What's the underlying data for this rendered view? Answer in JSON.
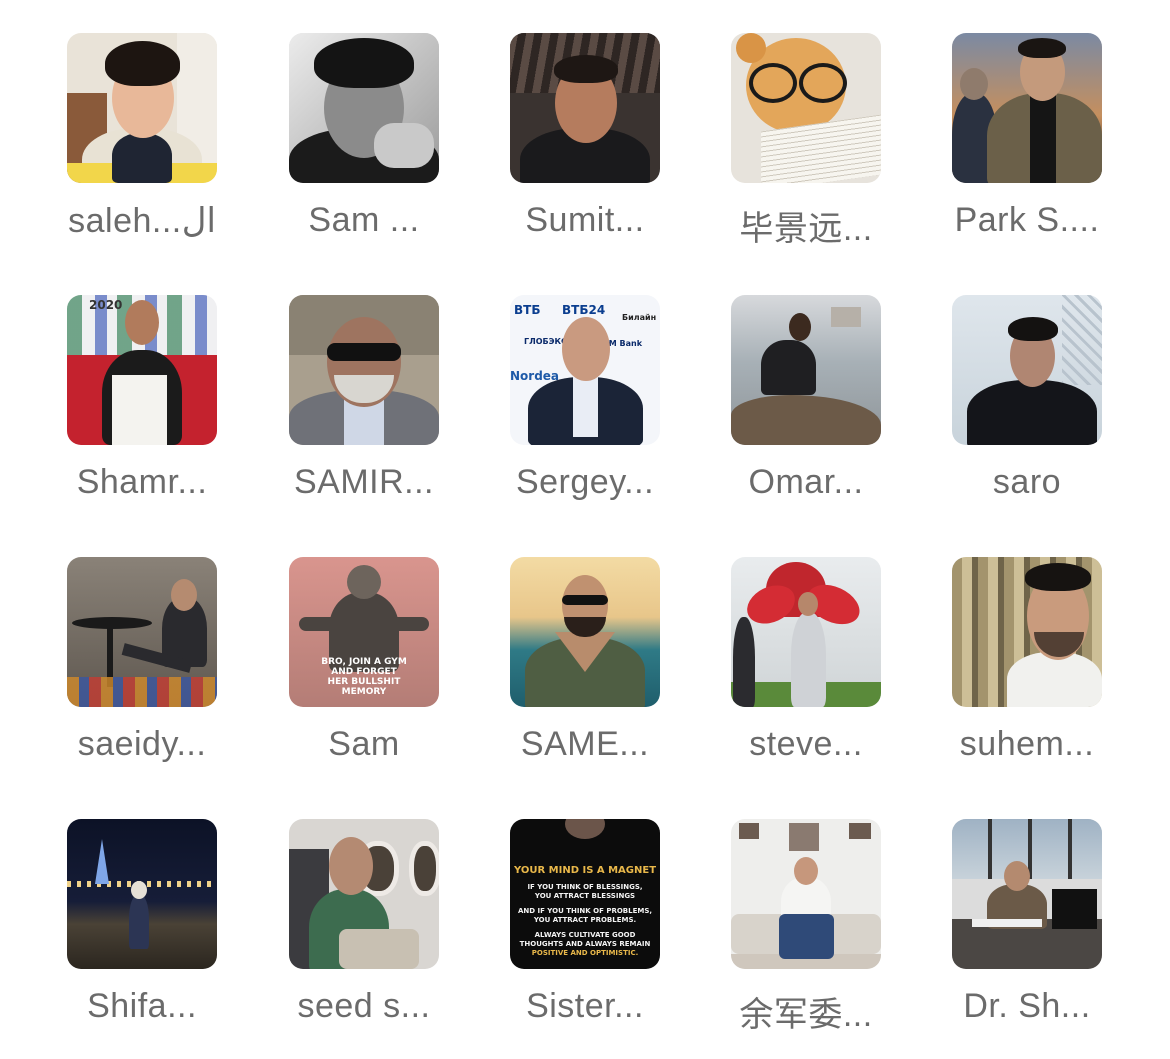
{
  "contacts": [
    {
      "name": "saleh...ال",
      "avatar_icon": "child-portrait"
    },
    {
      "name": "Sam ...",
      "avatar_icon": "bw-man-portrait"
    },
    {
      "name": "Sumit...",
      "avatar_icon": "man-selfie"
    },
    {
      "name": "毕景远...",
      "avatar_icon": "teddy-bear-glasses"
    },
    {
      "name": "Park S....",
      "avatar_icon": "man-city-night"
    },
    {
      "name": "Shamr...",
      "avatar_icon": "man-red-sofa"
    },
    {
      "name": "SAMIR...",
      "avatar_icon": "man-sunglasses-car"
    },
    {
      "name": "Sergey...",
      "avatar_icon": "man-bank-logos"
    },
    {
      "name": "Omar...",
      "avatar_icon": "man-by-water"
    },
    {
      "name": "saro",
      "avatar_icon": "man-snow"
    },
    {
      "name": "saeidy...",
      "avatar_icon": "man-reading-table"
    },
    {
      "name": "Sam",
      "avatar_icon": "silhouette-gym-quote"
    },
    {
      "name": "SAME...",
      "avatar_icon": "man-heart-hands-sea"
    },
    {
      "name": "steve...",
      "avatar_icon": "men-red-flower-statue"
    },
    {
      "name": "suhem...",
      "avatar_icon": "man-selfie-market"
    },
    {
      "name": "Shifa...",
      "avatar_icon": "woman-beach-night"
    },
    {
      "name": "seed s...",
      "avatar_icon": "man-airplane"
    },
    {
      "name": "Sister...",
      "avatar_icon": "magnet-quote"
    },
    {
      "name": "余军委...",
      "avatar_icon": "man-sofa-room"
    },
    {
      "name": "Dr. Sh...",
      "avatar_icon": "man-office-desk"
    }
  ],
  "gym_quote": [
    "BRO, JOIN A GYM",
    "AND FORGET",
    "HER BULLSHIT",
    "MEMORY"
  ],
  "magnet_quote": {
    "title": "YOUR MIND IS A MAGNET",
    "lines": [
      "IF YOU THINK OF BLESSINGS,",
      "YOU ATTRACT BLESSINGS",
      "AND IF YOU THINK OF PROBLEMS,",
      "YOU ATTRACT PROBLEMS.",
      "ALWAYS CULTIVATE GOOD",
      "THOUGHTS AND ALWAYS REMAIN",
      "POSITIVE AND OPTIMISTIC."
    ]
  },
  "bank_logos": [
    "ВТБ",
    "ВТБ24",
    "Билайн",
    "ГЛОБЭКС",
    "ОМ Bank",
    "Nordea"
  ],
  "colors": {
    "name_text": "#6b6b6b",
    "background": "#ffffff"
  }
}
